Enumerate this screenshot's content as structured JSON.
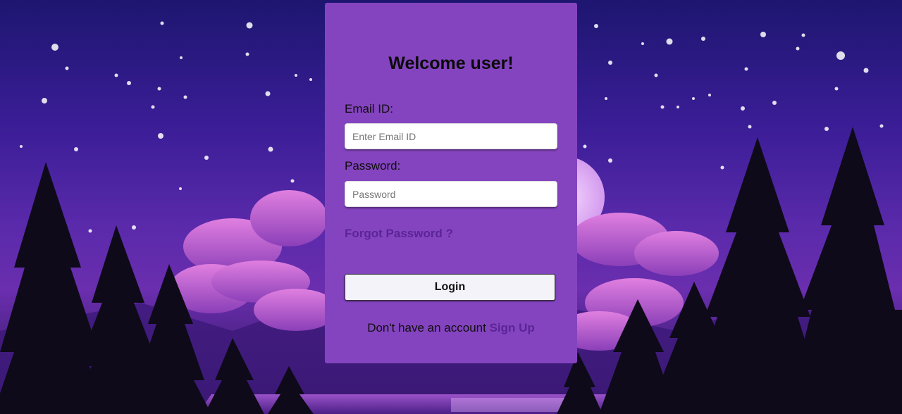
{
  "login": {
    "title": "Welcome user!",
    "email_label": "Email ID:",
    "email_placeholder": "Enter Email ID",
    "password_label": "Password:",
    "password_placeholder": "Password",
    "forgot_password": "Forgot Password ?",
    "login_button": "Login",
    "signup_prompt": "Don't have an account",
    "signup_link": "Sign Up"
  },
  "colors": {
    "card": "#8544bf",
    "link": "#5b2496",
    "sky": "#2b1a8a"
  }
}
